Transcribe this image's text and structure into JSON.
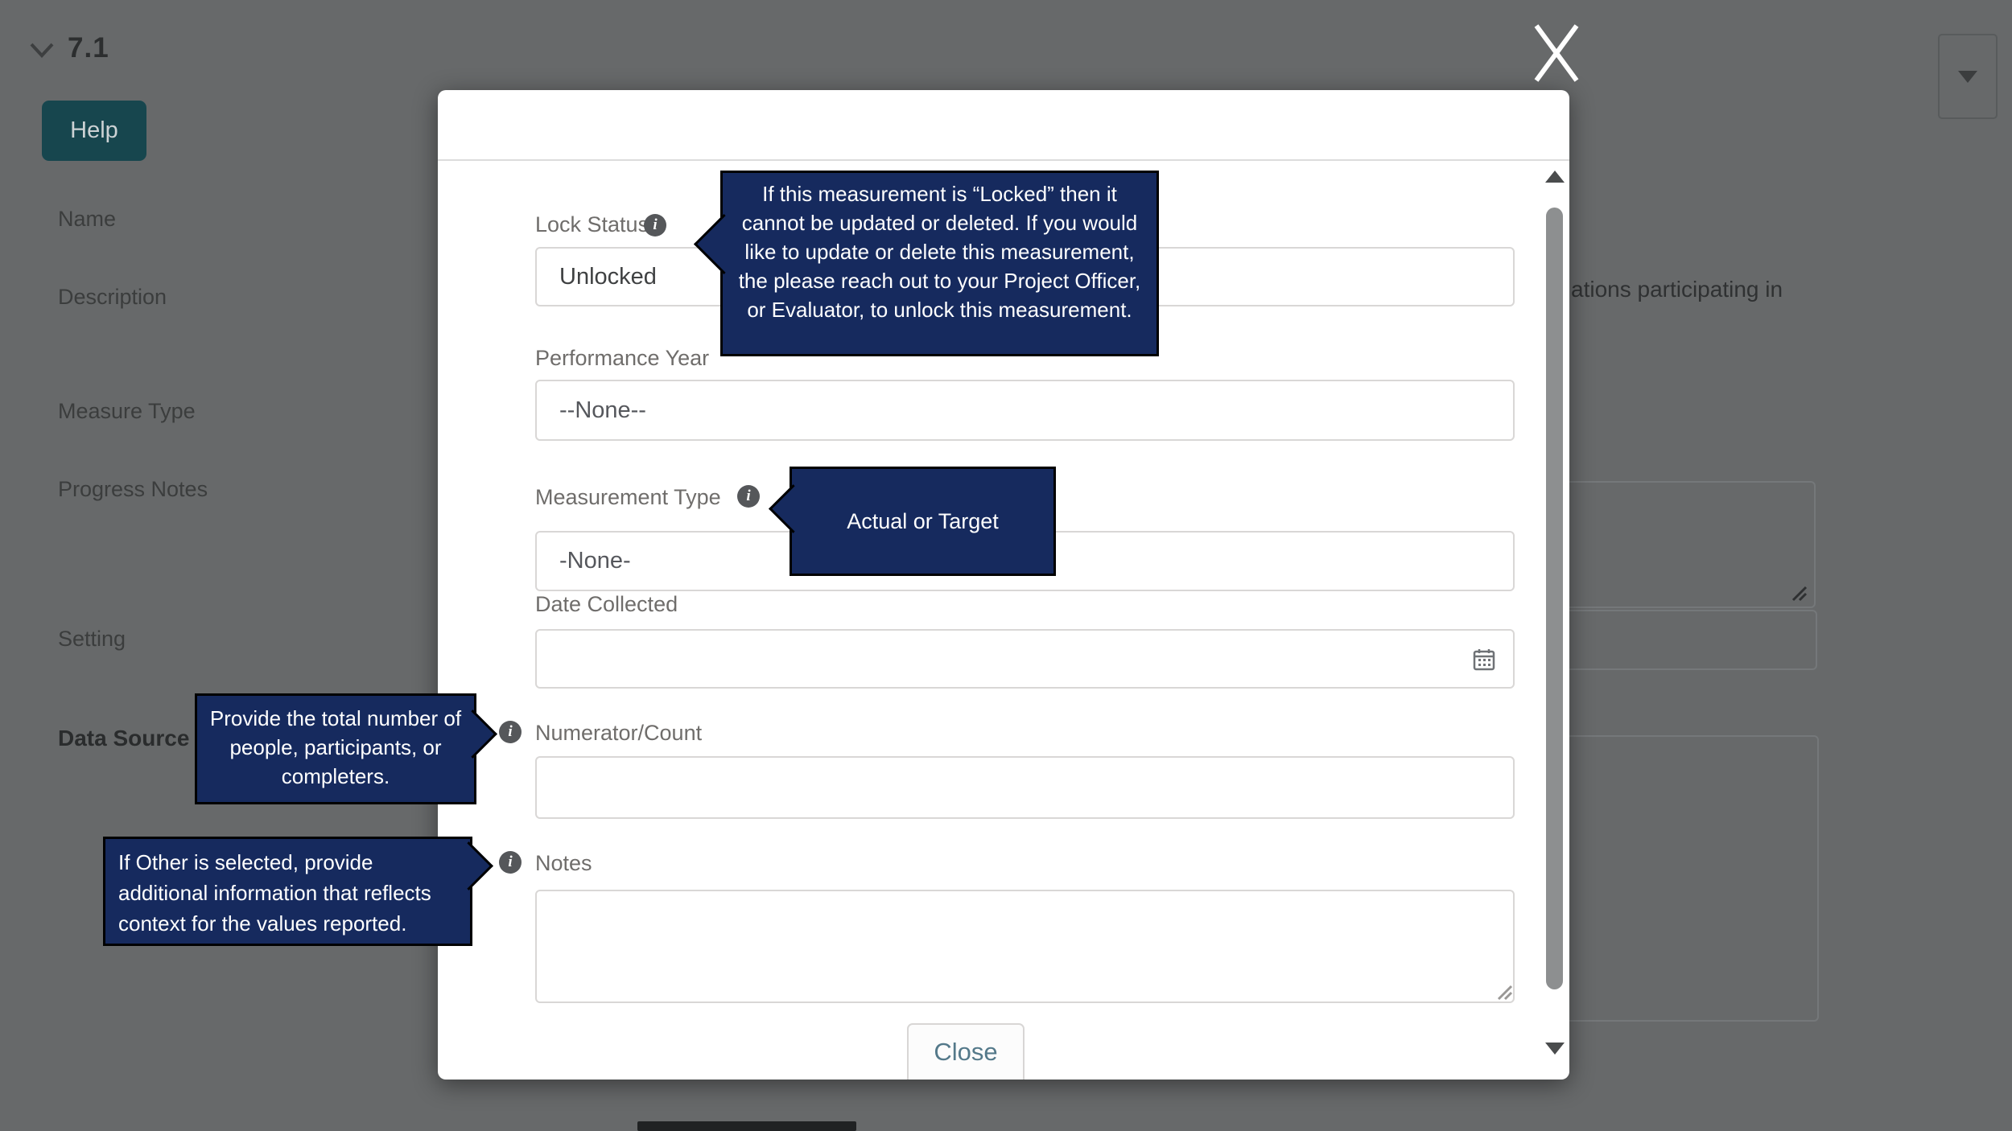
{
  "background": {
    "section_id": "7.1",
    "help_label": "Help",
    "field_labels": [
      "Name",
      "Description",
      "Measure Type",
      "Progress Notes",
      "Setting",
      "Data Source"
    ],
    "description_tail": "ations participating in"
  },
  "modal": {
    "fields": {
      "lock_status": {
        "label": "Lock Status",
        "value": "Unlocked"
      },
      "performance_year": {
        "label": "Performance Year",
        "value": "--None--"
      },
      "measurement_type": {
        "label": "Measurement Type",
        "value": "-None-"
      },
      "date_collected": {
        "label": "Date Collected",
        "value": ""
      },
      "numerator": {
        "label": "Numerator/Count",
        "value": ""
      },
      "notes": {
        "label": "Notes",
        "value": ""
      }
    },
    "close_label": "Close"
  },
  "tooltips": {
    "lock_status": "If this measurement is “Locked” then it cannot be updated or deleted. If you would like to update or delete this measurement, the please reach out to your Project Officer, or Evaluator, to unlock this measurement.",
    "measurement_type": "Actual or Target",
    "numerator": "Provide the total number of people, participants, or completers.",
    "notes": "If Other is selected, provide additional information that reflects context for the values reported."
  },
  "icons": {
    "info": "info-icon (ⓘ)",
    "calendar": "calendar-icon",
    "close": "x-icon",
    "chevron": "chevron-down-icon",
    "dropdown_caret": "caret-down-icon"
  },
  "colors": {
    "overlay_gray": "#67696a",
    "tooltip_bg": "#162a5e",
    "help_button_bg": "#17464e",
    "close_text": "#54798a",
    "modal_bg": "#ffffff"
  }
}
